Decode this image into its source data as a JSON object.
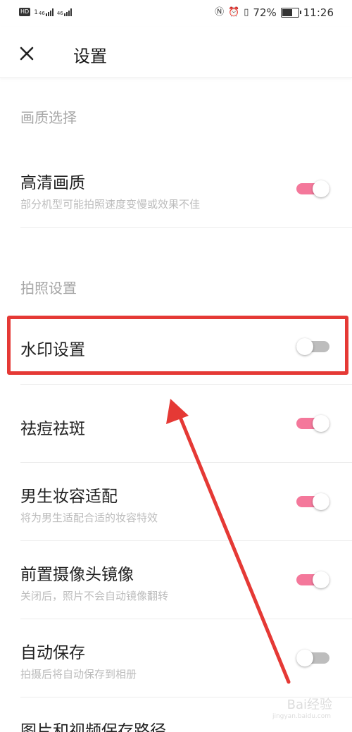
{
  "status_bar": {
    "hd": "HD",
    "sim1": "1",
    "net1": "46",
    "net2": "46",
    "battery_percent": "72%",
    "battery_level": 0.72,
    "time": "11:26",
    "icons": [
      "nfc-icon",
      "alarm-icon",
      "vibrate-icon",
      "battery-icon"
    ]
  },
  "header": {
    "close_icon": "close-icon",
    "title": "设置"
  },
  "sections": {
    "quality": {
      "title": "画质选择"
    },
    "photo": {
      "title": "拍照设置"
    }
  },
  "settings": {
    "hd_quality": {
      "label": "高清画质",
      "sub": "部分机型可能拍照速度变慢或效果不佳",
      "enabled": true
    },
    "watermark": {
      "label": "水印设置",
      "enabled": false
    },
    "acne": {
      "label": "祛痘祛斑",
      "enabled": true
    },
    "male_makeup": {
      "label": "男生妆容适配",
      "sub": "将为男生适配合适的妆容特效",
      "enabled": true
    },
    "front_mirror": {
      "label": "前置摄像头镜像",
      "sub": "关闭后，照片不会自动镜像翻转",
      "enabled": true
    },
    "auto_save": {
      "label": "自动保存",
      "sub": "拍摄后将自动保存到相册",
      "enabled": false
    },
    "save_path": {
      "label": "图片和视频保存路径"
    }
  },
  "colors": {
    "accent_on": "#f4789b",
    "toggle_off": "#bdbdbd",
    "annotation": "#e53935"
  },
  "watermark_overlay": {
    "text": "Bai经验",
    "url": "jingyan.baidu.com"
  }
}
